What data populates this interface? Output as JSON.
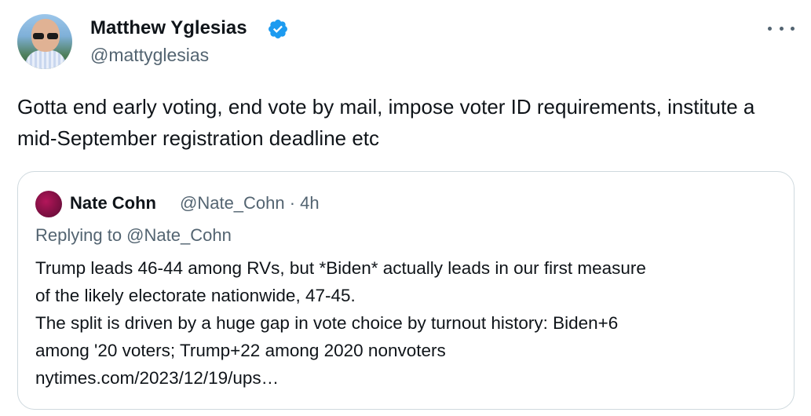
{
  "author": {
    "display_name": "Matthew Yglesias",
    "handle": "@mattyglesias",
    "verified": true,
    "verified_color": "#1d9bf0"
  },
  "tweet_text": "Gotta end early voting, end vote by mail, impose voter ID requirements, institute a mid-September registration deadline etc",
  "quoted_tweet": {
    "display_name": "Nate Cohn",
    "meta": "@Nate_Cohn · 4h",
    "replying_to": "Replying to @Nate_Cohn",
    "lines": [
      "Trump leads 46-44 among RVs, but *Biden* actually leads in our first measure",
      "of the likely electorate nationwide, 47-45.",
      "The split is driven by a huge gap in vote choice by turnout history: Biden+6",
      "among '20 voters; Trump+22 among 2020 nonvoters",
      "nytimes.com/2023/12/19/ups…"
    ]
  },
  "icons": {
    "verified": "verified-badge-icon",
    "more": "more-dots-icon"
  }
}
